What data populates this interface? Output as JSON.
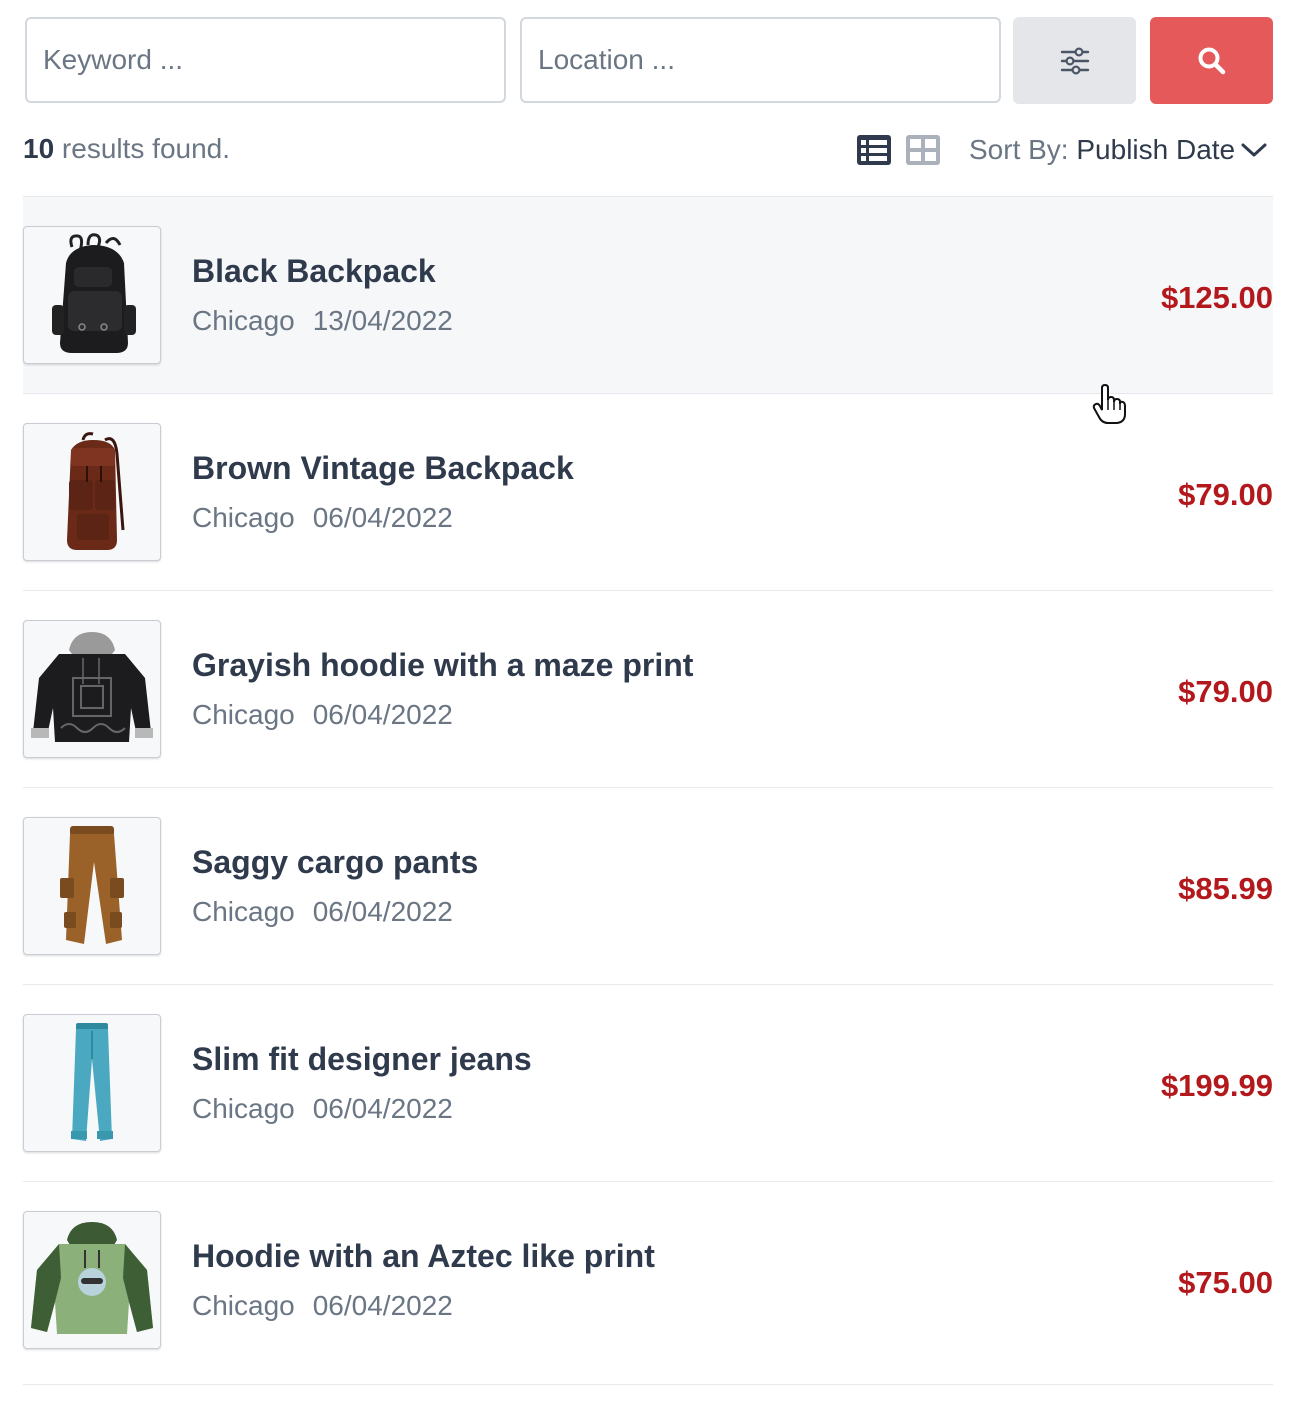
{
  "search": {
    "keyword_placeholder": "Keyword ...",
    "location_placeholder": "Location ...",
    "filter_icon": "sliders-icon",
    "search_icon": "search-icon",
    "search_color": "#e5595b"
  },
  "results": {
    "count": "10",
    "label": " results found."
  },
  "view": {
    "list_icon": "list-view-icon",
    "grid_icon": "grid-view-icon",
    "active": "list"
  },
  "sort": {
    "label": "Sort By:",
    "value": "Publish Date"
  },
  "listings": [
    {
      "title": "Black Backpack",
      "location": "Chicago",
      "date": "13/04/2022",
      "price": "$125.00",
      "image": "black-backpack"
    },
    {
      "title": "Brown Vintage Backpack",
      "location": "Chicago",
      "date": "06/04/2022",
      "price": "$79.00",
      "image": "brown-backpack"
    },
    {
      "title": "Grayish hoodie with a maze print",
      "location": "Chicago",
      "date": "06/04/2022",
      "price": "$79.00",
      "image": "black-hoodie"
    },
    {
      "title": "Saggy cargo pants",
      "location": "Chicago",
      "date": "06/04/2022",
      "price": "$85.99",
      "image": "cargo-pants"
    },
    {
      "title": "Slim fit designer jeans",
      "location": "Chicago",
      "date": "06/04/2022",
      "price": "$199.99",
      "image": "blue-jeans"
    },
    {
      "title": "Hoodie with an Aztec like print",
      "location": "Chicago",
      "date": "06/04/2022",
      "price": "$75.00",
      "image": "green-hoodie"
    }
  ],
  "colors": {
    "price": "#b3191c",
    "text": "#2f3a4c",
    "muted": "#6b7684"
  }
}
